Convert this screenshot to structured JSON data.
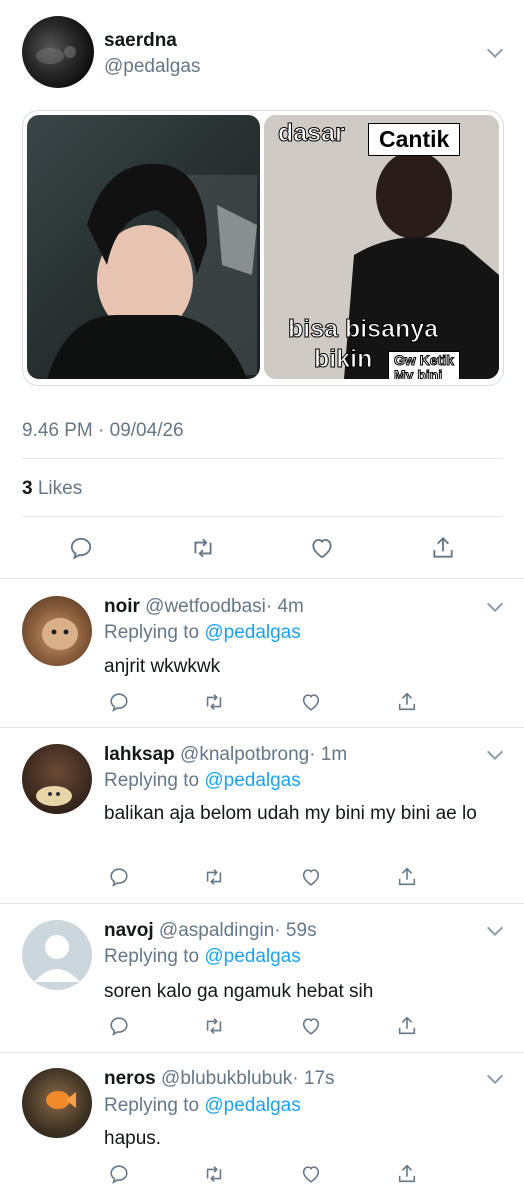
{
  "tweet": {
    "name": "saerdna",
    "handle": "@pedalgas",
    "meme_text": {
      "top_left": "dasar",
      "top_right": "Cantik",
      "bottom1": "bisa bisanya",
      "bottom2": "bikin",
      "tag1": "Gw Ketik",
      "tag2": "My bini"
    },
    "timestamp": "9.46 PM · 09/04/26",
    "likes_count": "3",
    "likes_label": "Likes"
  },
  "replies": [
    {
      "name": "noir",
      "handle": "@wetfoodbasi",
      "time": "· 4m",
      "replying_prefix": "Replying to",
      "replying_to": "@pedalgas",
      "text": "anjrit wkwkwk"
    },
    {
      "name": "lahksap",
      "handle": "@knalpotbrong",
      "time": "· 1m",
      "replying_prefix": "Replying to",
      "replying_to": "@pedalgas",
      "text": "balikan aja belom udah my bini my bini ae lo"
    },
    {
      "name": "navoj",
      "handle": "@aspaldingin",
      "time": "· 59s",
      "replying_prefix": "Replying to",
      "replying_to": "@pedalgas",
      "text": "soren kalo ga ngamuk hebat sih"
    },
    {
      "name": "neros",
      "handle": "@blubukblubuk",
      "time": "· 17s",
      "replying_prefix": "Replying to",
      "replying_to": "@pedalgas",
      "text": "hapus."
    }
  ],
  "colors": {
    "accent": "#1da1f2",
    "text": "#14171a",
    "muted": "#657786",
    "border": "#e1e8ed"
  }
}
